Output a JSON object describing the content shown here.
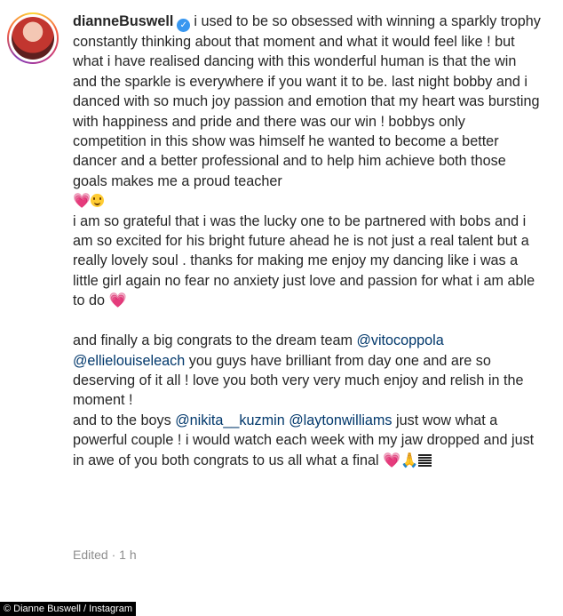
{
  "post": {
    "username": "dianneBuswell",
    "segments": [
      {
        "type": "text",
        "text": "i used to be so obsessed with winning a sparkly trophy constantly thinking about that moment and what it would feel like ! but what i have realised dancing with this wonderful human is that the win and the sparkle is everywhere if you want it to be. last night bobby and i danced with so much joy passion and emotion that my heart was bursting with happiness and pride and there was our win ! bobbys only competition in this show was himself he wanted to become a better dancer and a better professional and to help him achieve both those goals makes me a proud teacher\n"
      },
      {
        "type": "heart",
        "text": "💗"
      },
      {
        "type": "smile",
        "text": ""
      },
      {
        "type": "text",
        "text": "\ni am so grateful that i was the lucky one to be partnered with bobs and i am so excited for his bright future ahead he is not just a real talent but a really lovely soul . thanks for making me enjoy my dancing like i was a little girl again no fear no anxiety just love and passion for what i am able to do "
      },
      {
        "type": "heart",
        "text": "💗"
      },
      {
        "type": "text",
        "text": "\n\nand finally a big congrats to the dream team "
      },
      {
        "type": "mention",
        "text": "@vitocoppola"
      },
      {
        "type": "text",
        "text": "\n"
      },
      {
        "type": "mention",
        "text": "@ellielouiseleach"
      },
      {
        "type": "text",
        "text": " you guys have brilliant from day one and are so deserving of it all ! love you both very very much enjoy and relish in the moment !\nand to the boys "
      },
      {
        "type": "mention",
        "text": "@nikita__kuzmin"
      },
      {
        "type": "text",
        "text": " "
      },
      {
        "type": "mention",
        "text": "@laytonwilliams"
      },
      {
        "type": "text",
        "text": " just wow what a powerful couple ! i would watch each week with my jaw dropped and just in awe of you both congrats to us all what a final "
      },
      {
        "type": "heart",
        "text": "💗"
      },
      {
        "type": "pray",
        "text": "🙏"
      },
      {
        "type": "flag",
        "text": ""
      }
    ],
    "meta": "Edited · 1 h"
  },
  "credit": "© Dianne Buswell / Instagram",
  "colors": {
    "mention": "#00376b",
    "verified": "#3897f0",
    "meta": "#8e8e8e",
    "heart": "#e84aa1"
  }
}
